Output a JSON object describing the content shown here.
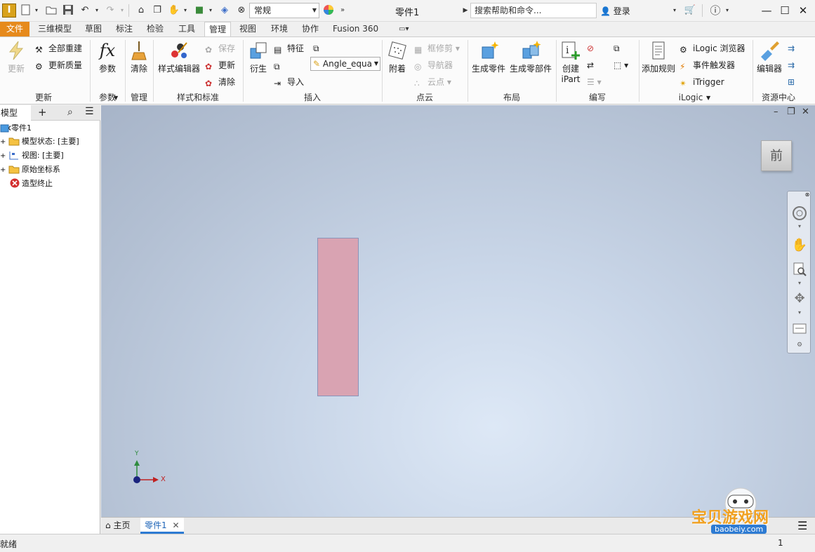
{
  "app": {
    "logo": "I",
    "style_select": "常规",
    "window_title": "零件1",
    "search_placeholder": "搜索帮助和命令...",
    "login": "登录"
  },
  "tabs": [
    {
      "label": "文件"
    },
    {
      "label": "三维模型"
    },
    {
      "label": "草图"
    },
    {
      "label": "标注"
    },
    {
      "label": "检验"
    },
    {
      "label": "工具"
    },
    {
      "label": "管理"
    },
    {
      "label": "视图"
    },
    {
      "label": "环境"
    },
    {
      "label": "协作"
    },
    {
      "label": "Fusion 360"
    }
  ],
  "ribbon": {
    "update": {
      "big": "更新",
      "rebuild_all": "全部重建",
      "update_mass": "更新质量",
      "panel": "更新"
    },
    "params": {
      "big": "参数",
      "icon_text": "fx",
      "panel": "参数"
    },
    "manage": {
      "big": "清除",
      "panel": "管理"
    },
    "styles": {
      "big": "样式编辑器",
      "save": "保存",
      "update": "更新",
      "clear": "清除",
      "panel": "样式和标准"
    },
    "insert": {
      "derive": "衍生",
      "feature": "特征",
      "import": "导入",
      "angle_value": "Angle_equa",
      "panel": "插入"
    },
    "pointcloud": {
      "attach": "附着",
      "crop": "框修剪",
      "navigator": "导航器",
      "points": "云点",
      "panel": "点云"
    },
    "layout": {
      "make_part": "生成零件",
      "make_components": "生成零部件",
      "panel": "布局"
    },
    "author": {
      "create_ipart_1": "创建",
      "create_ipart_2": "iPart",
      "panel": "编写"
    },
    "ilogic": {
      "add_rule": "添加规则",
      "browser": "iLogic 浏览器",
      "event_trigger": "事件触发器",
      "itrigger": "iTrigger",
      "panel": "iLogic"
    },
    "content": {
      "editor": "编辑器",
      "panel": "资源中心"
    }
  },
  "browser": {
    "tab_label": "模型",
    "items": [
      {
        "label": "零件1"
      },
      {
        "label": "模型状态: [主要]"
      },
      {
        "label": "视图: [主要]"
      },
      {
        "label": "原始坐标系"
      },
      {
        "label": "造型终止"
      }
    ]
  },
  "viewport": {
    "viewcube_face": "前",
    "axis_x": "X",
    "axis_y": "Y"
  },
  "doc_tabs": {
    "home": "主页",
    "part": "零件1"
  },
  "status": {
    "message": "就绪",
    "page": "1"
  },
  "watermark": {
    "name": "宝贝游戏网",
    "url": "baobeiy.com"
  },
  "colors": {
    "file_tab": "#e68a1c",
    "sketch_rect_fill": "#d9a3b2",
    "accent_blue": "#2d7bd3"
  }
}
